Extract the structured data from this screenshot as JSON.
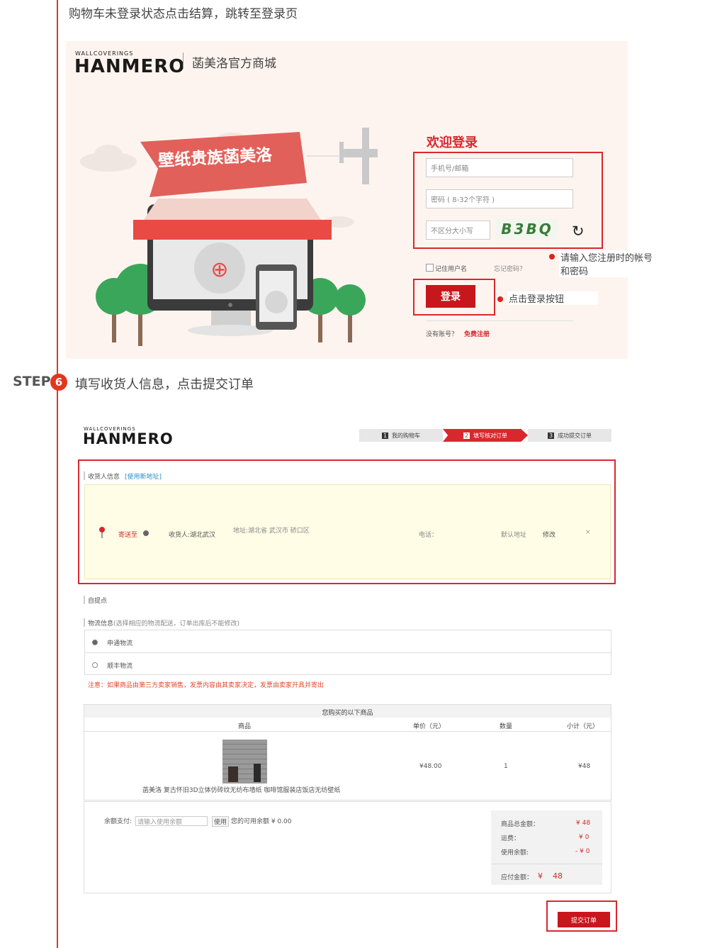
{
  "caption_top": "购物车未登录状态点击结算，跳转至登录页",
  "brand": {
    "small": "WALLCOVERINGS",
    "name": "HANMERO",
    "store": "菡美洛官方商城"
  },
  "banner_text": "壁纸贵族菡美洛",
  "login": {
    "title": "欢迎登录",
    "phone_placeholder": "手机号/邮箱",
    "password_placeholder": "密码 ( 8-32个字符 )",
    "captcha_placeholder": "不区分大小写",
    "captcha_text": "B3BQ",
    "remember": "记住用户名",
    "forgot": "忘记密码？",
    "login_button": "登录",
    "no_account": "没有账号？",
    "register": "免费注册"
  },
  "notes": {
    "account_line1": "请输入您注册时的帐号",
    "account_line2": "和密码",
    "click_login": "点击登录按钮"
  },
  "step": {
    "label": "STEP",
    "number": "6",
    "title": "填写收货人信息，点击提交订单"
  },
  "progress": [
    {
      "num": "1",
      "label": "我的购物车"
    },
    {
      "num": "2",
      "label": "填写核对订单"
    },
    {
      "num": "3",
      "label": "成功提交订单"
    }
  ],
  "receiver": {
    "header": "收货人信息",
    "new_address": "[使用新地址]",
    "send_to": "寄送至",
    "name": "收货人:湖北武汉",
    "address": "地址:湖北省 武汉市 硚口区",
    "phone": "电话：",
    "default": "默认地址",
    "edit": "修改",
    "delete": "×"
  },
  "pickup": "自提点",
  "logistics": {
    "header": "物流信息",
    "header_note": "(选择相应的物流配送，订单出库后不能修改)",
    "option1": "申通物流",
    "option2": "顺丰物流",
    "note_prefix": "注意：",
    "note": "如果商品由第三方卖家销售，发票内容由其卖家决定，发票由卖家开具并寄出"
  },
  "order": {
    "header": "您购买的以下商品",
    "columns": [
      "商品",
      "单价（元）",
      "数量",
      "小计（元）"
    ],
    "product_name": "菡美洛 复古怀旧3D立体仿砖纹无纺布墙纸 咖啡馆服装店饭店无纺壁纸",
    "unit_price": "¥48.00",
    "quantity": "1",
    "subtotal": "¥48"
  },
  "balance": {
    "label": "余额支付:",
    "placeholder": "请输入使用余额",
    "use": "使用",
    "available": "您的可用余额 ¥ 0.00"
  },
  "summary": {
    "total_label": "商品总金额：",
    "total_value": "¥  48",
    "shipping_label": "运费：",
    "shipping_value": "¥  0",
    "balance_label": "使用余额:",
    "balance_value": "- ¥  0",
    "payable_label": "应付金额：",
    "payable_value": "¥    48"
  },
  "submit": "提交订单",
  "colors": {
    "accent": "#d8282e",
    "line": "#d93a2b",
    "panel": "#fdf4ef",
    "address_bg": "#fffde6"
  }
}
